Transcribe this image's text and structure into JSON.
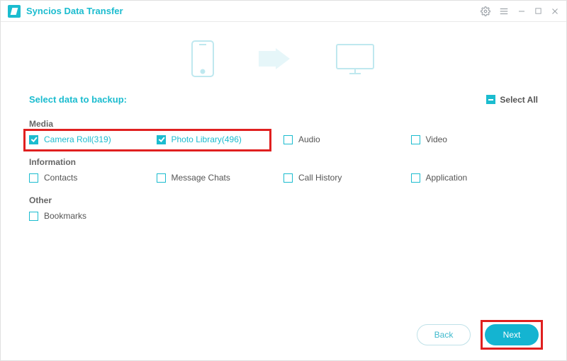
{
  "app_title": "Syncios Data Transfer",
  "section_title": "Select data to backup:",
  "select_all_label": "Select All",
  "groups": {
    "media": {
      "label": "Media"
    },
    "information": {
      "label": "Information"
    },
    "other": {
      "label": "Other"
    }
  },
  "media_items": {
    "camera_roll": {
      "label": "Camera Roll(319)",
      "checked": true
    },
    "photo_library": {
      "label": "Photo Library(496)",
      "checked": true
    },
    "audio": {
      "label": "Audio",
      "checked": false
    },
    "video": {
      "label": "Video",
      "checked": false
    }
  },
  "info_items": {
    "contacts": {
      "label": "Contacts",
      "checked": false
    },
    "message_chats": {
      "label": "Message Chats",
      "checked": false
    },
    "call_history": {
      "label": "Call History",
      "checked": false
    },
    "application": {
      "label": "Application",
      "checked": false
    }
  },
  "other_items": {
    "bookmarks": {
      "label": "Bookmarks",
      "checked": false
    }
  },
  "buttons": {
    "back": "Back",
    "next": "Next"
  }
}
